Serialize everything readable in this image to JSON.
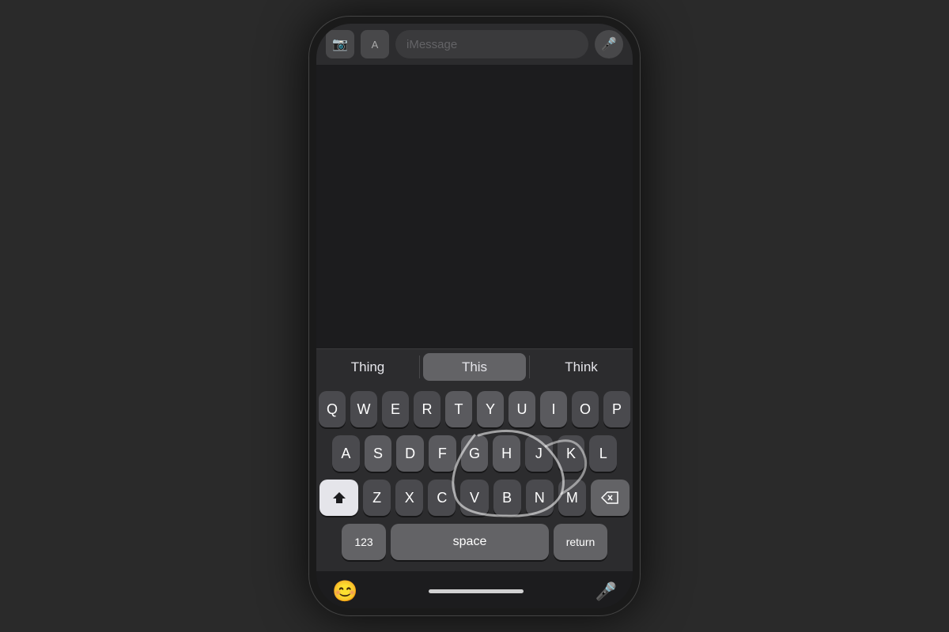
{
  "background": "#2a2a2a",
  "phone": {
    "top_bar": {
      "placeholder": "iMessage",
      "camera_icon": "📷",
      "mic_icon": "🎤"
    },
    "autocomplete": {
      "items": [
        "Thing",
        "This",
        "Think"
      ],
      "active_index": 1
    },
    "keyboard": {
      "rows": [
        [
          "Q",
          "W",
          "E",
          "R",
          "T",
          "Y",
          "U",
          "I",
          "O",
          "P"
        ],
        [
          "A",
          "S",
          "D",
          "F",
          "G",
          "H",
          "J",
          "K",
          "L"
        ],
        [
          "Z",
          "X",
          "C",
          "V",
          "B",
          "N",
          "M"
        ]
      ],
      "special_keys": {
        "shift": "⬆",
        "backspace": "⌫",
        "numbers": "123",
        "space": "space",
        "return": "return"
      }
    },
    "bottom": {
      "emoji": "😊",
      "mic": "🎤"
    }
  }
}
